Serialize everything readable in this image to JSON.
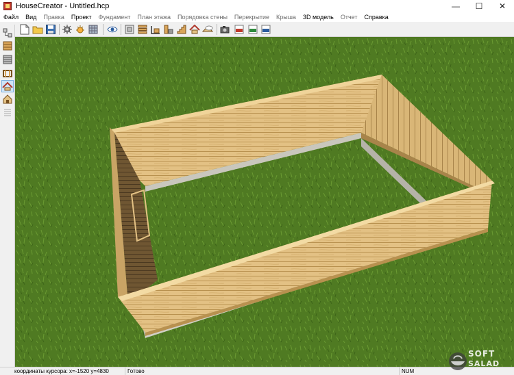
{
  "window": {
    "title": "HouseCreator - Untitled.hcp",
    "minimize_glyph": "—",
    "maximize_glyph": "☐",
    "close_glyph": "✕"
  },
  "menu": [
    {
      "label": "Файл",
      "enabled": true
    },
    {
      "label": "Вид",
      "enabled": true
    },
    {
      "label": "Правка",
      "enabled": false
    },
    {
      "label": "Проект",
      "enabled": true
    },
    {
      "label": "Фундамент",
      "enabled": false
    },
    {
      "label": "План этажа",
      "enabled": false
    },
    {
      "label": "Порядовка стены",
      "enabled": false
    },
    {
      "label": "Перекрытие",
      "enabled": false
    },
    {
      "label": "Крыша",
      "enabled": false
    },
    {
      "label": "3D модель",
      "enabled": true
    },
    {
      "label": "Отчет",
      "enabled": false
    },
    {
      "label": "Справка",
      "enabled": true
    }
  ],
  "toolbar_icons": [
    "new-file-icon",
    "open-folder-icon",
    "save-icon",
    "settings-gear-icon",
    "sun-settings-icon",
    "texture-icon",
    "view-eye-icon",
    "foundation-plan-icon",
    "wall-logs-icon",
    "floor-plan-icon",
    "wall-section-icon",
    "stairs-icon",
    "roof-icon",
    "roof-snow-icon",
    "camera-icon",
    "export-pdf-icon",
    "export-xls-icon",
    "export-3d-icon"
  ],
  "sidebar_icons": [
    "project-tree-icon",
    "foundation-icon",
    "log-wall-icon",
    "floor-frame-icon",
    "roof-mode-icon",
    "house-3d-icon",
    "list-icon"
  ],
  "status": {
    "cursor": "координаты курсора: x=-1520 y=4830",
    "state": "Готово",
    "num": "NUM"
  },
  "watermark": {
    "line1": "SOFT",
    "line2": "SALAD"
  },
  "colors": {
    "grass": "#4f7a22",
    "wood_light": "#e3c184",
    "wood_dark": "#6f5632",
    "foundation": "#c9c7bd"
  }
}
